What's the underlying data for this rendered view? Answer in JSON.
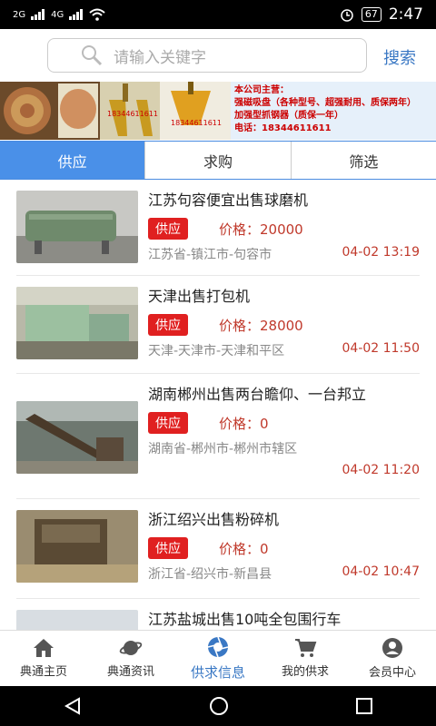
{
  "status": {
    "signal_1": "2G",
    "signal_2": "4G",
    "battery": "67",
    "time": "2:47"
  },
  "search": {
    "placeholder": "请输入关键字",
    "button": "搜索"
  },
  "banner": {
    "lines": [
      "本公司主营：",
      "强磁吸盘（各种型号、超强耐用、质保两年）",
      "加强型抓钢器（质保一年）",
      "电话：18344611611"
    ],
    "phone_small": "18344611611"
  },
  "tabs": [
    {
      "label": "供应",
      "active": true
    },
    {
      "label": "求购"
    },
    {
      "label": "筛选"
    }
  ],
  "items": [
    {
      "title": "江苏句容便宜出售球磨机",
      "tag": "供应",
      "price": "价格：20000",
      "location": "江苏省-镇江市-句容市",
      "time": "04-02 13:19"
    },
    {
      "title": "天津出售打包机",
      "tag": "供应",
      "price": "价格：28000",
      "location": "天津-天津市-天津和平区",
      "time": "04-02 11:50"
    },
    {
      "title": "湖南郴州出售两台瞻仰、一台邦立",
      "tag": "供应",
      "price": "价格：0",
      "location": "湖南省-郴州市-郴州市辖区",
      "time": "04-02 11:20"
    },
    {
      "title": "浙江绍兴出售粉碎机",
      "tag": "供应",
      "price": "价格：0",
      "location": "浙江省-绍兴市-新昌县",
      "time": "04-02 10:47"
    },
    {
      "title": "江苏盐城出售10吨全包围行车"
    }
  ],
  "nav": [
    {
      "label": "典通主页",
      "icon": "home-icon"
    },
    {
      "label": "典通资讯",
      "icon": "planet-icon"
    },
    {
      "label": "供求信息",
      "icon": "aperture-icon",
      "active": true
    },
    {
      "label": "我的供求",
      "icon": "cart-icon"
    },
    {
      "label": "会员中心",
      "icon": "user-icon"
    }
  ],
  "colors": {
    "accent": "#4a90e8",
    "price": "#c0392b",
    "tag": "#e02020"
  }
}
